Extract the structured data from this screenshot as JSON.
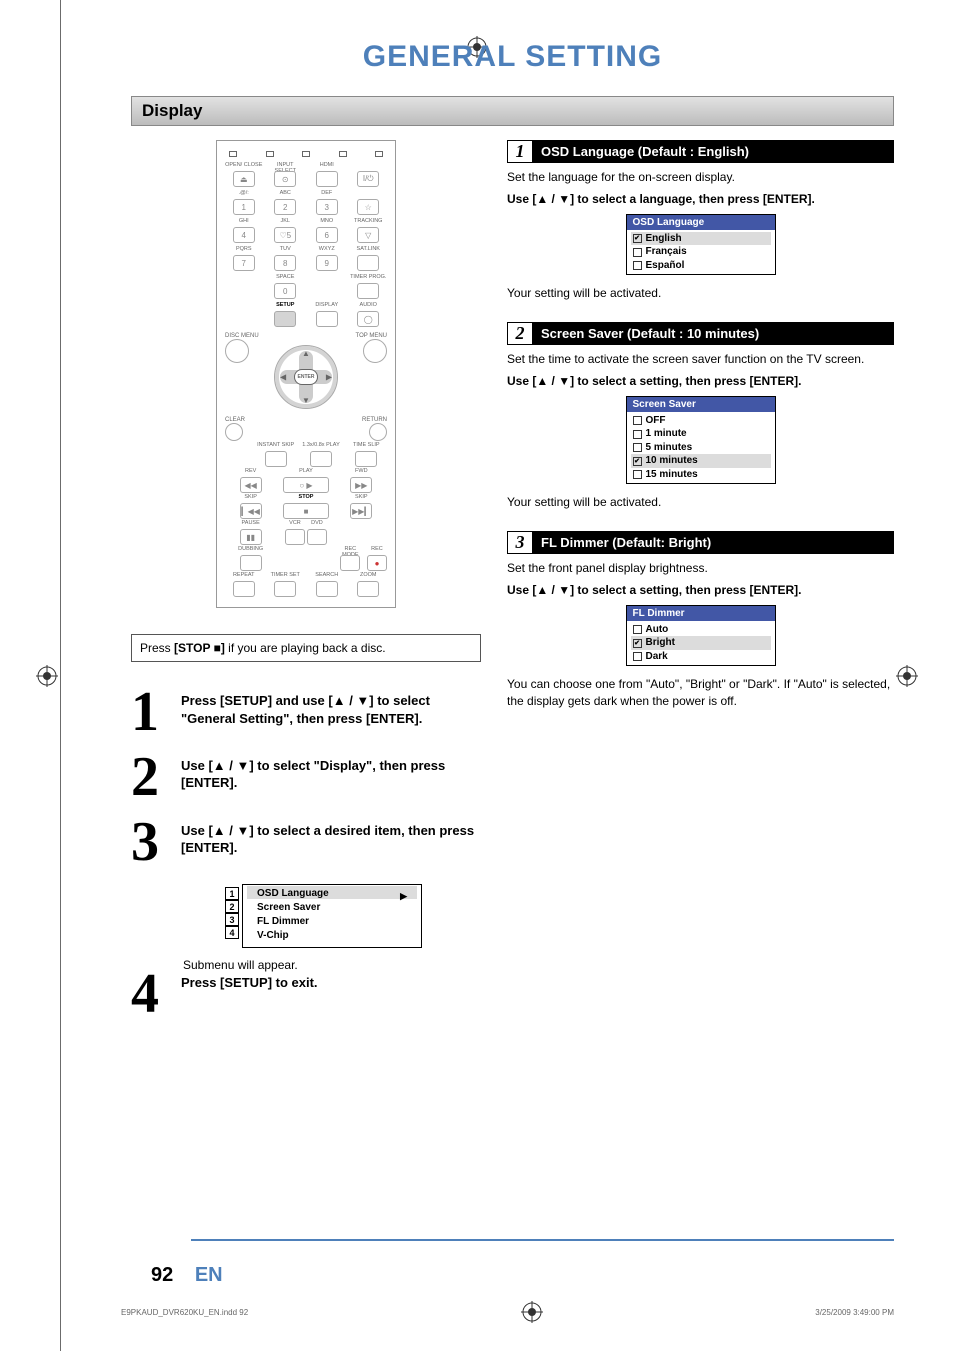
{
  "title": "GENERAL SETTING",
  "section": "Display",
  "note": {
    "prefix": "Press ",
    "stop": "[STOP ■]",
    "suffix": " if you are playing back a disc."
  },
  "remote": {
    "row1": [
      "OPEN/\nCLOSE",
      "INPUT\nSELECT",
      "HDMI",
      ""
    ],
    "row1_btn": [
      "⏏",
      "⊙",
      "",
      "I/⏻"
    ],
    "row2_lbl": [
      ".@/:",
      "ABC",
      "DEF",
      ""
    ],
    "row2_btn": [
      "1",
      "2",
      "3",
      "☆"
    ],
    "row3_lbl": [
      "GHI",
      "JKL",
      "MNO",
      "TRACKING"
    ],
    "row3_btn": [
      "4",
      "♡5",
      "6",
      "▽"
    ],
    "row4_lbl": [
      "PQRS",
      "TUV",
      "WXYZ",
      "SAT.LINK"
    ],
    "row4_btn": [
      "7",
      "8",
      "9",
      ""
    ],
    "row5_lbl": [
      "",
      "SPACE",
      "",
      "TIMER\nPROG."
    ],
    "row5_btn": [
      "",
      "0",
      "",
      ""
    ],
    "row6_lbl": [
      "",
      "SETUP",
      "DISPLAY",
      "AUDIO"
    ],
    "row6_btn": [
      "",
      "",
      "",
      "◯"
    ],
    "disc_menu": "DISC MENU",
    "top_menu": "TOP MENU",
    "enter": "ENTER",
    "clear": "CLEAR",
    "return": "RETURN",
    "rpt": "INSTANT\nSKIP",
    "rpt2": "1.3x/0.8x\nPLAY",
    "rpt3": "TIME SLIP",
    "rev": "REV",
    "play": "PLAY",
    "fwd": "FWD",
    "skip": "SKIP",
    "stop": "STOP",
    "skip2": "SKIP",
    "pause": "PAUSE",
    "vcr": "VCR",
    "dvd": "DVD",
    "dubbing": "DUBBING",
    "recmode": "REC MODE",
    "rec": "REC",
    "bot": [
      "REPEAT",
      "TIMER SET",
      "SEARCH",
      "ZOOM"
    ]
  },
  "steps": [
    {
      "num": "1",
      "text_pre": "Press ",
      "b1": "[SETUP]",
      "mid": " and use ",
      "b2": "[▲ / ▼]",
      "mid2": " to select \"General Setting\", then press ",
      "b3": "[ENTER]",
      "suf": "."
    },
    {
      "num": "2",
      "text_pre": "Use ",
      "b1": "[▲ / ▼]",
      "mid": " to select \"Display\", then press ",
      "b2": "[ENTER]",
      "suf": "."
    },
    {
      "num": "3",
      "text_pre": "Use ",
      "b1": "[▲ / ▼]",
      "mid": " to select a desired item, then press ",
      "b2": "[ENTER]",
      "suf": "."
    },
    {
      "num": "4",
      "text_pre": "Press ",
      "b1": "[SETUP]",
      "mid": " to exit.",
      "b2": "",
      "suf": ""
    }
  ],
  "step3_menu": {
    "items": [
      "OSD Language",
      "Screen Saver",
      "FL Dimmer",
      "V-Chip"
    ],
    "badges": [
      "1",
      "2",
      "3",
      "4"
    ]
  },
  "step3_note": "Submenu will appear.",
  "right": [
    {
      "num": "1",
      "title": "OSD Language (Default : English)",
      "desc": "Set the language for the on-screen display.",
      "instr": "Use [▲ / ▼] to select a language, then press [ENTER].",
      "menu_head": "OSD Language",
      "menu_items": [
        {
          "lbl": "English",
          "sel": true,
          "chk": true
        },
        {
          "lbl": "Français",
          "sel": false,
          "chk": false
        },
        {
          "lbl": "Español",
          "sel": false,
          "chk": false
        }
      ],
      "after": "Your setting will be activated."
    },
    {
      "num": "2",
      "title": "Screen Saver (Default : 10 minutes)",
      "desc": "Set the time to activate the screen saver function on the TV screen.",
      "instr": "Use [▲ / ▼] to select a setting, then press [ENTER].",
      "menu_head": "Screen Saver",
      "menu_items": [
        {
          "lbl": "OFF",
          "sel": false,
          "chk": false
        },
        {
          "lbl": "1 minute",
          "sel": false,
          "chk": false
        },
        {
          "lbl": "5 minutes",
          "sel": false,
          "chk": false
        },
        {
          "lbl": "10 minutes",
          "sel": true,
          "chk": true
        },
        {
          "lbl": "15 minutes",
          "sel": false,
          "chk": false
        }
      ],
      "after": "Your setting will be activated."
    },
    {
      "num": "3",
      "title": "FL Dimmer (Default: Bright)",
      "desc": "Set the front panel display brightness.",
      "instr": "Use [▲ / ▼] to select a setting, then press [ENTER].",
      "menu_head": "FL Dimmer",
      "menu_items": [
        {
          "lbl": "Auto",
          "sel": false,
          "chk": false
        },
        {
          "lbl": "Bright",
          "sel": true,
          "chk": true
        },
        {
          "lbl": "Dark",
          "sel": false,
          "chk": false
        }
      ],
      "after": "You can choose one from \"Auto\", \"Bright\" or \"Dark\". If \"Auto\" is selected, the display gets dark when the power is off."
    }
  ],
  "page_num": "92",
  "page_lang": "EN",
  "footer_file": "E9PKAUD_DVR620KU_EN.indd   92",
  "footer_time": "3/25/2009   3:49:00 PM"
}
